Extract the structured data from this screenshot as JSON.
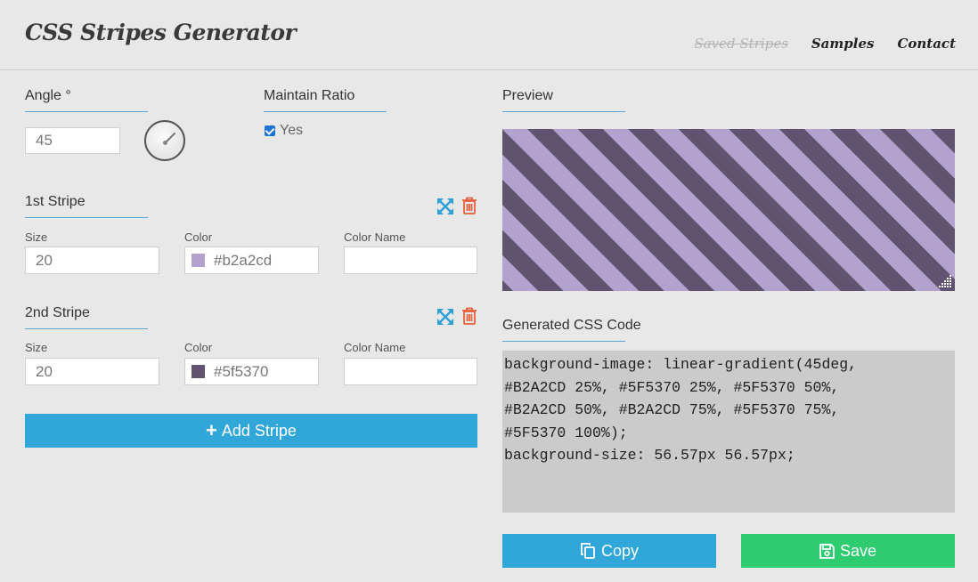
{
  "header": {
    "title": "CSS Stripes Generator",
    "nav": {
      "saved": "Saved Stripes",
      "samples": "Samples",
      "contact": "Contact"
    }
  },
  "angle": {
    "label": "Angle °",
    "value": "45",
    "degrees": 45
  },
  "ratio": {
    "label": "Maintain Ratio",
    "checkbox_label": "Yes",
    "checked": true
  },
  "stripes": [
    {
      "title": "1st Stripe",
      "size_label": "Size",
      "size": "20",
      "color_label": "Color",
      "color": "#b2a2cd",
      "name_label": "Color Name",
      "name": ""
    },
    {
      "title": "2nd Stripe",
      "size_label": "Size",
      "size": "20",
      "color_label": "Color",
      "color": "#5f5370",
      "name_label": "Color Name",
      "name": ""
    }
  ],
  "add_button": "Add Stripe",
  "preview": {
    "label": "Preview"
  },
  "code": {
    "label": "Generated CSS Code",
    "text": "background-image: linear-gradient(45deg,\n#B2A2CD 25%, #5F5370 25%, #5F5370 50%,\n#B2A2CD 50%, #B2A2CD 75%, #5F5370 75%,\n#5F5370 100%);\nbackground-size: 56.57px 56.57px;"
  },
  "actions": {
    "copy": "Copy",
    "save": "Save"
  },
  "colors": {
    "accent": "#31a6d9",
    "save_green": "#2ecc71",
    "delete_red": "#e8603c",
    "expand_blue": "#2f9fd8"
  }
}
